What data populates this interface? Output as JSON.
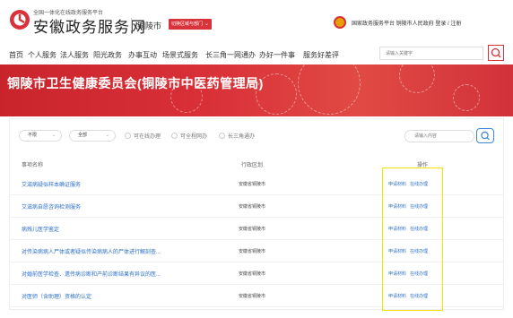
{
  "header": {
    "brand_small": "全国一体化在线政务服务平台",
    "brand_big": "安徽政务服务网",
    "city": "铜陵市",
    "city_switch": "切换区域与部门",
    "top_links": "国家政务服务平台 铜陵市人民政府 登录 / 注册"
  },
  "nav": {
    "items": [
      "首页",
      "个人服务",
      "法人服务",
      "阳光政务",
      "办事互动",
      "场景式服务",
      "长三角一网通办",
      "办好一件事",
      "服务好差评"
    ],
    "search_placeholder": "请输入关键字"
  },
  "banner": {
    "title": "铜陵市卫生健康委员会(铜陵市中医药管理局)"
  },
  "filters": {
    "select_1": "不限",
    "select_2": "全部",
    "radio_1": "可在线办理",
    "radio_2": "可全程网办",
    "radio_3": "长三角通办",
    "search_placeholder": "请输入内容"
  },
  "table": {
    "headers": {
      "name": "事项名称",
      "region": "行政区划",
      "ops": "操作"
    },
    "rows": [
      {
        "name": "艾滋病疑似样本确证服务",
        "region": "安徽省铜陵市",
        "op1": "申请材料",
        "op2": "在线办理"
      },
      {
        "name": "艾滋病自愿咨询检测服务",
        "region": "安徽省铜陵市",
        "op1": "申请材料",
        "op2": "在线办理"
      },
      {
        "name": "病残儿医学鉴定",
        "region": "安徽省铜陵市",
        "op1": "申请材料",
        "op2": "在线办理"
      },
      {
        "name": "对传染病病人尸体或者疑似传染病病人的尸体进行解剖查...",
        "region": "安徽省铜陵市",
        "op1": "申请材料",
        "op2": "在线办理"
      },
      {
        "name": "对婚前医学检查、遗传病诊断和产前诊断结果有异议的医...",
        "region": "安徽省铜陵市",
        "op1": "申请材料",
        "op2": "在线办理"
      },
      {
        "name": "对医师（含助理）资格的认定",
        "region": "安徽省铜陵市",
        "op1": "申请材料",
        "op2": "在线办理"
      }
    ]
  },
  "colors": {
    "brand_red": "#d8323a",
    "link_blue": "#2c6fc6",
    "highlight": "#f2e200"
  }
}
